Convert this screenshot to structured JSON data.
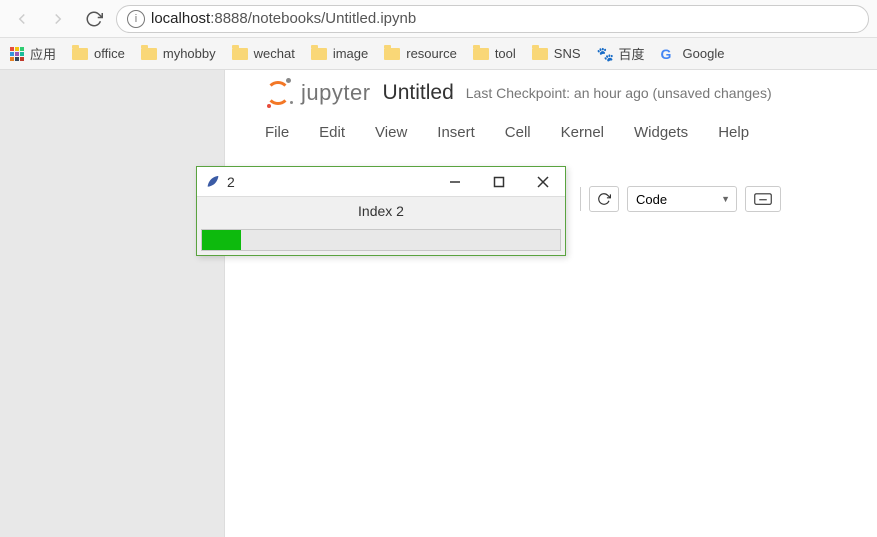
{
  "browser": {
    "url_prefix": "localhost",
    "url_rest": ":8888/notebooks/Untitled.ipynb"
  },
  "bookmarks": {
    "apps": "应用",
    "items": [
      "office",
      "myhobby",
      "wechat",
      "image",
      "resource",
      "tool",
      "SNS"
    ],
    "baidu": "百度",
    "google": "Google"
  },
  "jupyter": {
    "brand": "jupyter",
    "title": "Untitled",
    "checkpoint": "Last Checkpoint: an hour ago (unsaved changes)",
    "menu": [
      "File",
      "Edit",
      "View",
      "Insert",
      "Cell",
      "Kernel",
      "Widgets",
      "Help"
    ],
    "cell_type": "Code"
  },
  "tk": {
    "title": "2",
    "label": "Index 2",
    "progress_pct": 11
  }
}
